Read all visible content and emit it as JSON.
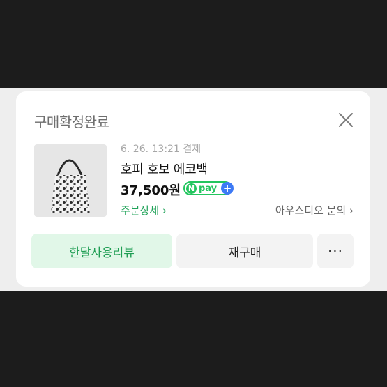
{
  "card": {
    "title": "구매확정완료",
    "close_icon": "close-icon",
    "order": {
      "datetime": "6. 26. 13:21 결제",
      "product_name": "호피 호보 에코백",
      "price": "37,500원",
      "payment_badge": {
        "icon": "npay-badge-icon",
        "n": "N",
        "text": "pay",
        "plus": "+"
      }
    },
    "links": {
      "order_detail": "주문상세",
      "seller_inquiry": "아우스디오 문의"
    },
    "buttons": {
      "review": "한달사용리뷰",
      "rebuy": "재구매",
      "more": "···"
    }
  },
  "colors": {
    "accent_green": "#23c55e",
    "link_green": "#22a35a",
    "review_bg": "#e1f7e8",
    "plus_blue": "#3d7af5"
  }
}
